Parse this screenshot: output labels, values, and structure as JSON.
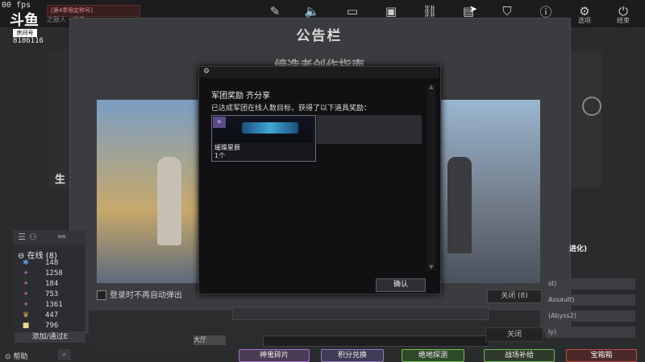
{
  "hud": {
    "fps": "00 fps",
    "logo": "斗鱼",
    "logo_tag": "房间号",
    "room_id": "8186116",
    "player_box": "[第4季限定称号]",
    "player_sub": "之敌人 · 作者"
  },
  "topbar": {
    "icons": [
      "edit-icon",
      "volume-icon",
      "camera-icon",
      "briefcase-icon",
      "link-icon",
      "gift-icon",
      "shield-icon",
      "info-icon",
      "gear-icon",
      "power-icon"
    ],
    "settings_label": "选项",
    "exit_label": "结束"
  },
  "bulletin": {
    "title": "公告栏",
    "subtitle": "缔造者创作指南",
    "left_text": "生",
    "autoclose_label": "登录时不再自动弹出",
    "close_label": "关闭 (8)"
  },
  "friends": {
    "online_label": "在线 (8)",
    "rows": [
      {
        "icon": "✱",
        "color": "#5aa0e0",
        "value": "148"
      },
      {
        "icon": "✦",
        "color": "#b455b4",
        "value": "1258"
      },
      {
        "icon": "✦",
        "color": "#b455b4",
        "value": "184"
      },
      {
        "icon": "✦",
        "color": "#b455b4",
        "value": "753"
      },
      {
        "icon": "✦",
        "color": "#b455b4",
        "value": "1361"
      },
      {
        "icon": "♛",
        "color": "#d8b84a",
        "value": "447"
      },
      {
        "icon": "■",
        "color": "#e8d88a",
        "value": "796"
      }
    ],
    "add_label": "添加/通过E",
    "help_label": "帮助"
  },
  "chat": {
    "channel": "大厅",
    "close_label": "关闭"
  },
  "right_list": {
    "evolve_label": "进化)",
    "items": [
      "st)",
      "Assault)",
      "(Abyss2)",
      "ly)"
    ]
  },
  "bottom_nav": [
    {
      "label": "神鬼碎片",
      "bg": "#4c3b56",
      "border": "#a36fd0"
    },
    {
      "label": "积分兑换",
      "bg": "#3d3b55",
      "border": "#8c7ac4"
    },
    {
      "label": "绝地探测",
      "bg": "#2f4a2a",
      "border": "#6cc04c"
    },
    {
      "label": "战场补给",
      "bg": "#2f3a2b",
      "border": "#6cb95a"
    },
    {
      "label": "宝箱箱",
      "bg": "#4a2828",
      "border": "#c04a4a"
    }
  ],
  "modal": {
    "title": "军团奖励  齐分享",
    "message": "已达成军团在线人数目标，获得了以下道具奖励：",
    "item_name": "璀璨星辰",
    "item_qty": "1个",
    "ok_label": "确认"
  }
}
